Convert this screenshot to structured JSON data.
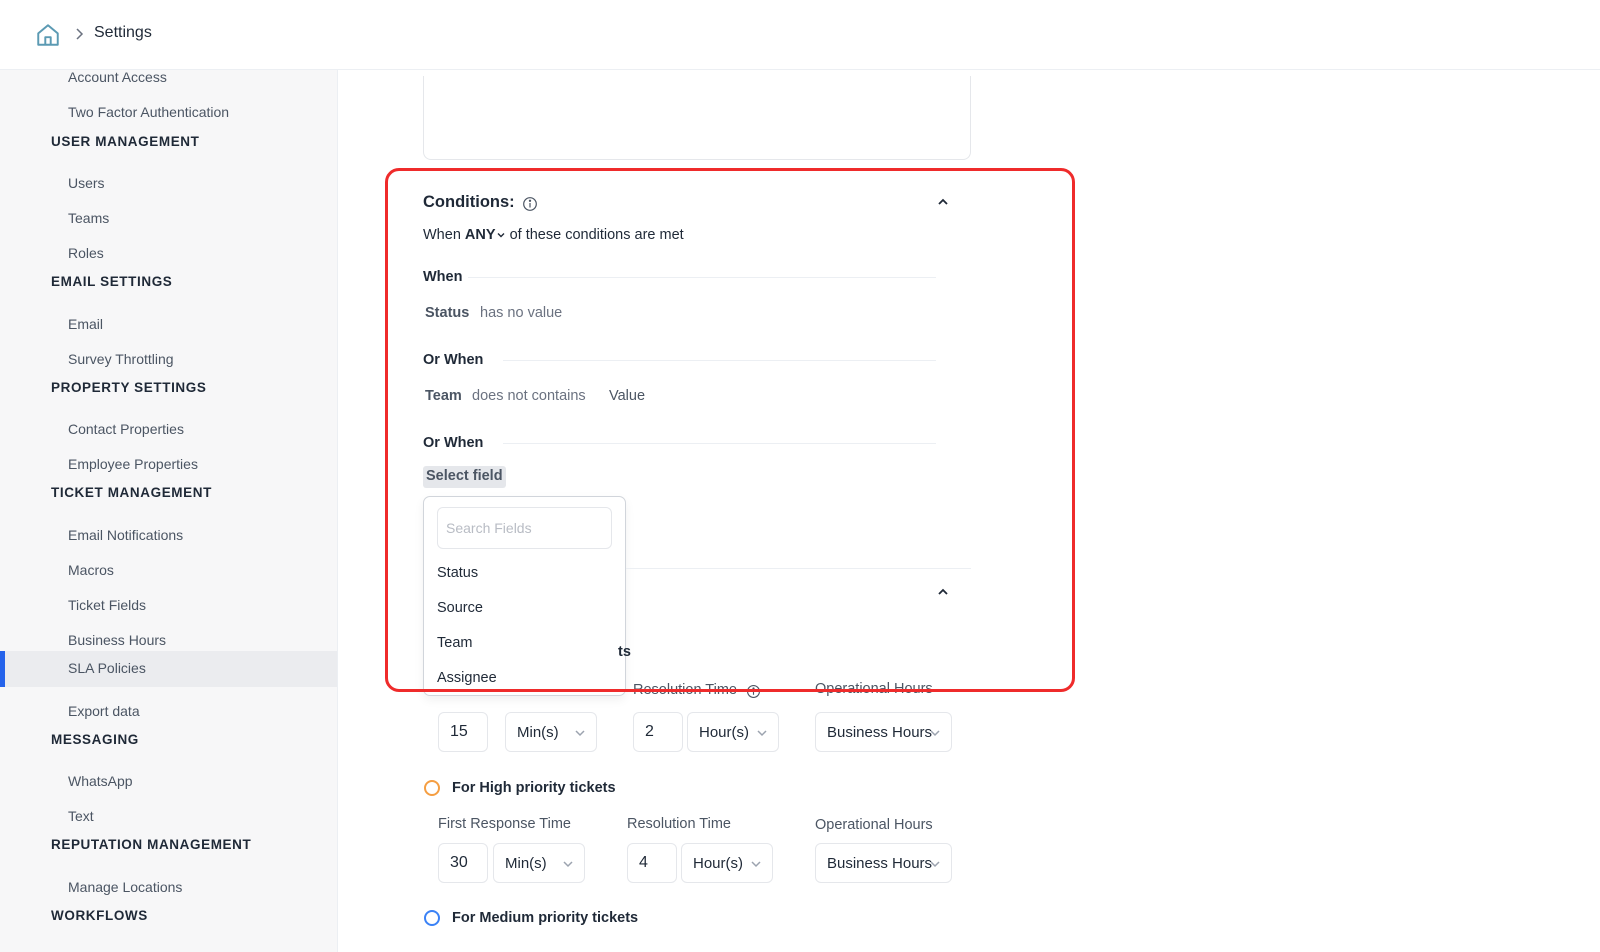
{
  "header": {
    "breadcrumb_current": "Settings"
  },
  "sidebar": {
    "sections": [
      {
        "title": "",
        "items": [
          "Account Access",
          "Two Factor Authentication"
        ]
      },
      {
        "title": "USER MANAGEMENT",
        "items": [
          "Users",
          "Teams",
          "Roles"
        ]
      },
      {
        "title": "EMAIL SETTINGS",
        "items": [
          "Email",
          "Survey Throttling"
        ]
      },
      {
        "title": "PROPERTY SETTINGS",
        "items": [
          "Contact Properties",
          "Employee Properties"
        ]
      },
      {
        "title": "TICKET MANAGEMENT",
        "items": [
          "Email Notifications",
          "Macros",
          "Ticket Fields",
          "Business Hours",
          "SLA Policies",
          "Export data"
        ]
      },
      {
        "title": "MESSAGING",
        "items": [
          "WhatsApp",
          "Text"
        ]
      },
      {
        "title": "REPUTATION MANAGEMENT",
        "items": [
          "Manage Locations"
        ]
      },
      {
        "title": "WORKFLOWS",
        "items": []
      }
    ],
    "active_item": "SLA Policies"
  },
  "conditions": {
    "title": "Conditions:",
    "when_prefix": "When",
    "match_mode": "ANY",
    "when_suffix": "of these conditions are met",
    "groups": [
      {
        "label": "When",
        "field": "Status",
        "operator": "has no value",
        "value": ""
      },
      {
        "label": "Or When",
        "field": "Team",
        "operator": "does not contains",
        "value": "Value"
      },
      {
        "label": "Or When",
        "field": "",
        "operator": "",
        "value": ""
      }
    ],
    "select_field_label": "Select field",
    "dropdown": {
      "search_placeholder": "Search Fields",
      "options": [
        "Status",
        "Source",
        "Team",
        "Assignee"
      ]
    }
  },
  "sla": {
    "partial_heading_fragment": "ts",
    "hidden_labels": {
      "resolution": "Resolution Time",
      "operational": "Operational Hours"
    },
    "urgent_row": {
      "first_response": "15",
      "first_unit": "Min(s)",
      "resolution": "2",
      "resolution_unit": "Hour(s)",
      "hours": "Business Hours"
    },
    "high": {
      "label": "For High priority tickets",
      "first_response_label": "First Response Time",
      "resolution_label": "Resolution Time",
      "operational_label": "Operational Hours",
      "first_response": "30",
      "first_unit": "Min(s)",
      "resolution": "4",
      "resolution_unit": "Hour(s)",
      "hours": "Business Hours",
      "color": "#f59e42"
    },
    "medium": {
      "label": "For Medium priority tickets",
      "color": "#3b82f6"
    }
  },
  "colors": {
    "highlight": "#ef2b2b",
    "active_accent": "#2563eb",
    "home_icon": "#5b9ab3"
  }
}
